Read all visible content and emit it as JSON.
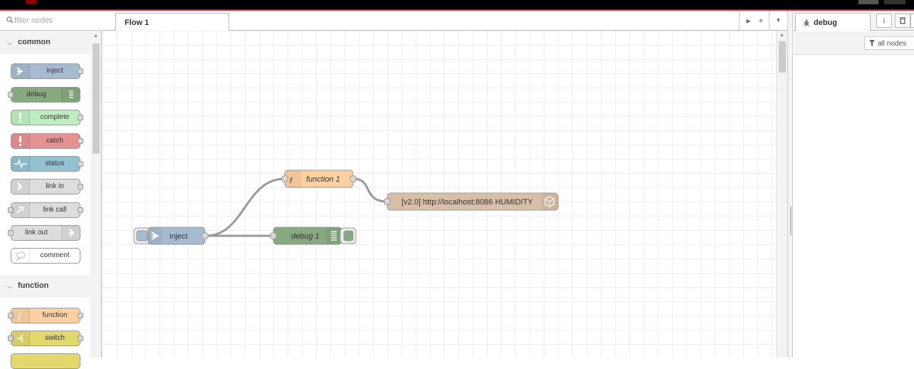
{
  "palette": {
    "filter_placeholder": "filter nodes",
    "categories": [
      {
        "label": "common",
        "nodes": [
          {
            "label": "inject",
            "color": "#a6bbcf",
            "icon": "inject-arrow-icon"
          },
          {
            "label": "debug",
            "color": "#87a980",
            "icon": "debug-list-icon"
          },
          {
            "label": "complete",
            "color": "#c0edc0",
            "icon": "exclamation-icon"
          },
          {
            "label": "catch",
            "color": "#e49191",
            "icon": "exclamation-icon"
          },
          {
            "label": "status",
            "color": "#94c1d0",
            "icon": "status-pulse-icon"
          },
          {
            "label": "link in",
            "color": "#dddddd",
            "icon": "link-in-icon"
          },
          {
            "label": "link call",
            "color": "#dddddd",
            "icon": "link-call-icon"
          },
          {
            "label": "link out",
            "color": "#dddddd",
            "icon": "link-out-icon"
          },
          {
            "label": "comment",
            "color": "#ffffff",
            "icon": "comment-icon"
          }
        ]
      },
      {
        "label": "function",
        "nodes": [
          {
            "label": "function",
            "color": "#fdd0a2",
            "icon": "function-f-icon"
          },
          {
            "label": "switch",
            "color": "#e2d96e",
            "icon": "switch-icon"
          }
        ]
      }
    ]
  },
  "workspace": {
    "tabs": [
      {
        "label": "Flow 1"
      }
    ],
    "flow_nodes": {
      "inject": {
        "label": "inject",
        "color": "#a6bbcf"
      },
      "function1": {
        "label": "function 1",
        "color": "#fdd0a2"
      },
      "influx": {
        "label": "[v2.0] http://localhost:8086 HUMIDITY",
        "color": "#d8bfa8"
      },
      "debug1": {
        "label": "debug 1",
        "color": "#87a980"
      }
    }
  },
  "sidebar": {
    "tab_label": "debug",
    "info_button": "i",
    "filter_label": "all nodes"
  }
}
